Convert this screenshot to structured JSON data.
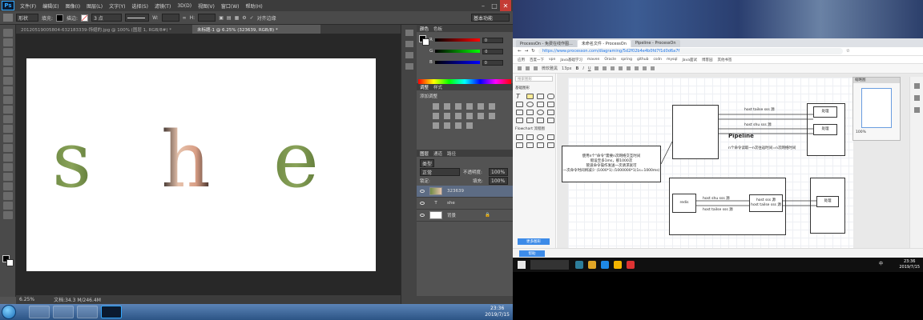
{
  "photoshop": {
    "logo": "Ps",
    "menu": [
      "文件(F)",
      "编辑(E)",
      "图像(I)",
      "图层(L)",
      "文字(Y)",
      "选择(S)",
      "滤镜(T)",
      "3D(D)",
      "视图(V)",
      "窗口(W)",
      "帮助(H)"
    ],
    "options": {
      "tool_preset": "形状",
      "fill_label": "填充:",
      "stroke_label": "描边:",
      "stroke_size": "3 点",
      "w_label": "W:",
      "h_label": "H:",
      "align_edges": "对齐边缘",
      "workspace": "基本功能"
    },
    "tabs": [
      "20120519005804-632183339-饰翅的.jpg @ 100% (图层 1, RGB/8#) *",
      "未标题-1 @ 6.25% (323639, RGB/8) *"
    ],
    "canvas_text": "she",
    "status": {
      "zoom": "6.25%",
      "doc": "文档:34.3 M/246.4M"
    },
    "panels": {
      "color_tab": "颜色",
      "swatches_tab": "色板",
      "color_rows": [
        {
          "label": "R",
          "value": "0"
        },
        {
          "label": "G",
          "value": "0"
        },
        {
          "label": "B",
          "value": "0"
        }
      ],
      "adjust_tab": "调整",
      "styles_tab": "样式",
      "adjust_title": "添加调整",
      "layers_tab": "图层",
      "channels_tab": "通道",
      "paths_tab": "路径",
      "kind": "类型",
      "blend_mode": "正常",
      "opacity_label": "不透明度:",
      "opacity": "100%",
      "lock_label": "锁定:",
      "fill_label": "填充:",
      "fill": "100%",
      "layers": [
        "323639",
        "she",
        "背景"
      ]
    }
  },
  "taskbar_win7": {
    "time": "23:36",
    "date": "2019/7/15"
  },
  "browser": {
    "tabs": [
      "ProcessOn - 免费在线作图...",
      "未命名文件 - ProcessOn",
      "Pipeline - ProcessOn"
    ],
    "url": "https://www.processon.com/diagraming/5d2f02b4e4b0fd7f1d0d6a7f",
    "bookmarks": [
      "应用",
      "百度一下",
      "vpn",
      "Java基础学习",
      "maven",
      "Oracle",
      "spring",
      "github",
      "csdn",
      "mysql",
      "Java面试",
      "博客园",
      "其他书签"
    ],
    "toolbar_font": "微软雅黑",
    "toolbar_size": "13px",
    "lib_search": "搜索图形",
    "lib_sec1": "基础图形",
    "lib_sec2": "Flowchart 流程图",
    "lib_more": "更多图形",
    "diagram": {
      "title": "Pipeline",
      "lines": [
        "host tailse sss 源",
        "host shu sss 源",
        "host shu sss 源",
        "host tailse sss 源",
        "host sse sss 源"
      ],
      "note": "n个命令读取一n次往返时间=n次网络时间",
      "text_box": [
        "使用n个\"命令\"需要n次网络交互时间",
        "假设至多1ms，那1000次",
        "管道命令操作发送一次请求就可",
        "一次命令时间将减少 (1000*1) /1000000*1(1s=1000ms)"
      ],
      "rediskey": "redis",
      "server_a": "处理",
      "server_b": "处理",
      "server_c": "处理",
      "mid_box": [
        "host sss 源",
        "host tailse sss 源"
      ]
    },
    "nav_title": "缩略图",
    "nav_zoom": "100%",
    "foot_button": "帮助",
    "bottom_left": "页面底部",
    "bottom_mid": "文件浏览",
    "bottom_right": "分享"
  },
  "taskbar_win10": {
    "time": "23:36",
    "date": "2019/7/15",
    "ime": "中"
  }
}
